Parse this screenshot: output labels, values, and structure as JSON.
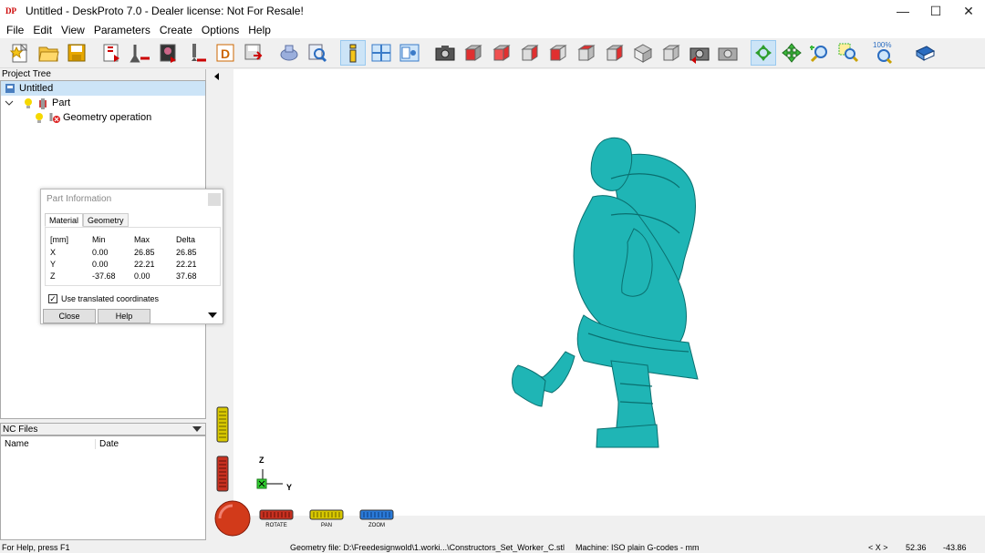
{
  "window": {
    "title": "Untitled - DeskProto 7.0 - Dealer license: Not For Resale!",
    "icon_text": "DP",
    "controls": [
      "minimize-icon",
      "maximize-icon",
      "close-icon"
    ]
  },
  "menu": [
    "File",
    "Edit",
    "View",
    "Parameters",
    "Create",
    "Options",
    "Help"
  ],
  "toolbar": {
    "zoom_label": "100%"
  },
  "project_tree": {
    "header": "Project Tree",
    "items": [
      {
        "label": "Untitled"
      },
      {
        "label": "Part"
      },
      {
        "label": "Geometry operation"
      }
    ]
  },
  "nc_files": {
    "header": "NC Files",
    "columns": [
      "Name",
      "Date"
    ]
  },
  "dialog": {
    "title": "Part Information",
    "tabs": [
      "Material",
      "Geometry"
    ],
    "header": [
      "[mm]",
      "Min",
      "Max",
      "Delta"
    ],
    "rows": [
      [
        "X",
        "0.00",
        "26.85",
        "26.85"
      ],
      [
        "Y",
        "0.00",
        "22.21",
        "22.21"
      ],
      [
        "Z",
        "-37.68",
        "0.00",
        "37.68"
      ]
    ],
    "checkbox_label": "Use translated coordinates",
    "checkbox_checked": true,
    "close_label": "Close",
    "help_label": "Help"
  },
  "axes": {
    "z": "Z",
    "y": "Y"
  },
  "view_controls": {
    "rotate": "ROTATE",
    "pan": "PAN",
    "zoom": "ZOOM"
  },
  "model_color": "#1fb5b5",
  "status": {
    "help": "For Help, press F1",
    "geometry_file": "Geometry file: D:\\Freedesignwold\\1.worki...\\Constructors_Set_Worker_C.stl",
    "machine": "Machine: ISO plain G-codes - mm",
    "coord_label": "< X >",
    "coord_x": "52.36",
    "coord_y": "-43.86"
  }
}
